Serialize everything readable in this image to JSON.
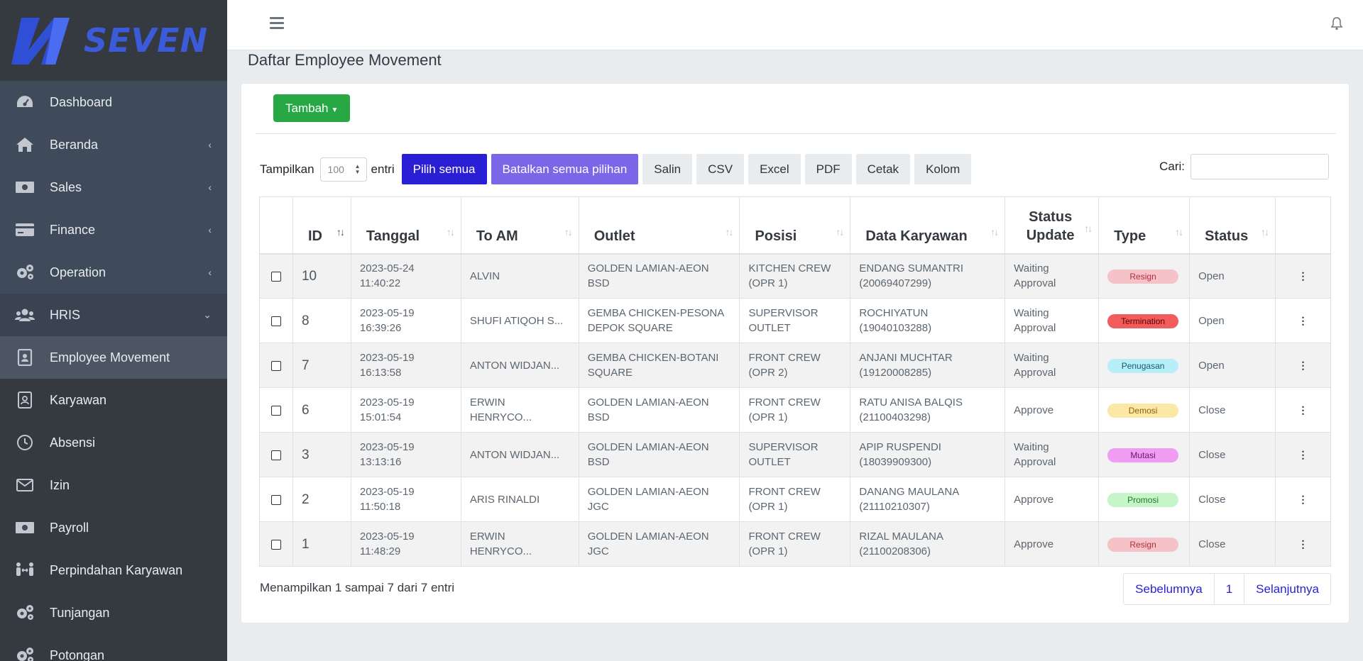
{
  "brand": {
    "name": "SEVEN",
    "color": "#3b5bdb"
  },
  "sidebar": {
    "items": [
      {
        "label": "Dashboard",
        "icon": "gauge-icon"
      },
      {
        "label": "Beranda",
        "icon": "home-icon",
        "chevron": "‹"
      },
      {
        "label": "Sales",
        "icon": "money-icon",
        "chevron": "‹"
      },
      {
        "label": "Finance",
        "icon": "credit-card-icon",
        "chevron": "‹"
      },
      {
        "label": "Operation",
        "icon": "cogs-icon",
        "chevron": "‹"
      },
      {
        "label": "HRIS",
        "icon": "users-icon",
        "chevron": "⌄"
      }
    ],
    "sub_items": [
      {
        "label": "Employee Movement",
        "icon": "id-badge-icon"
      },
      {
        "label": "Karyawan",
        "icon": "id-card-icon"
      },
      {
        "label": "Absensi",
        "icon": "clock-icon"
      },
      {
        "label": "Izin",
        "icon": "envelope-icon"
      },
      {
        "label": "Payroll",
        "icon": "money-icon"
      },
      {
        "label": "Perpindahan Karyawan",
        "icon": "people-arrows-icon"
      },
      {
        "label": "Tunjangan",
        "icon": "cogs-icon"
      },
      {
        "label": "Potongan",
        "icon": "cogs-icon"
      }
    ]
  },
  "page": {
    "title": "Daftar Employee Movement"
  },
  "toolbar": {
    "add_label": "Tambah",
    "show_label": "Tampilkan",
    "page_length": "100",
    "entries_label": "entri",
    "select_all": "Pilih semua",
    "deselect_all": "Batalkan semua pilihan",
    "buttons": [
      "Salin",
      "CSV",
      "Excel",
      "PDF",
      "Cetak",
      "Kolom"
    ],
    "search_label": "Cari:"
  },
  "table": {
    "columns": [
      "ID",
      "Tanggal",
      "To AM",
      "Outlet",
      "Posisi",
      "Data Karyawan",
      "Status Update",
      "Type",
      "Status"
    ],
    "rows": [
      {
        "id": "10",
        "date": "2023-05-24",
        "time": "11:40:22",
        "to_am": "ALVIN",
        "outlet1": "GOLDEN LAMIAN-AEON",
        "outlet2": "BSD",
        "pos1": "KITCHEN CREW",
        "pos2": "(OPR 1)",
        "name": "ENDANG SUMANTRI",
        "nik": "(20069407299)",
        "su1": "Waiting",
        "su2": "Approval",
        "type": "Resign",
        "status": "Open"
      },
      {
        "id": "8",
        "date": "2023-05-19",
        "time": "16:39:26",
        "to_am": "SHUFI ATIQOH S...",
        "outlet1": "GEMBA CHICKEN-PESONA",
        "outlet2": "DEPOK SQUARE",
        "pos1": "SUPERVISOR",
        "pos2": "OUTLET",
        "name": "ROCHIYATUN",
        "nik": "(19040103288)",
        "su1": "Waiting",
        "su2": "Approval",
        "type": "Termination",
        "status": "Open"
      },
      {
        "id": "7",
        "date": "2023-05-19",
        "time": "16:13:58",
        "to_am": "ANTON WIDJAN...",
        "outlet1": "GEMBA CHICKEN-BOTANI",
        "outlet2": "SQUARE",
        "pos1": "FRONT CREW",
        "pos2": "(OPR 2)",
        "name": "ANJANI MUCHTAR",
        "nik": "(19120008285)",
        "su1": "Waiting",
        "su2": "Approval",
        "type": "Penugasan",
        "status": "Open"
      },
      {
        "id": "6",
        "date": "2023-05-19",
        "time": "15:01:54",
        "to_am": "ERWIN HENRYCO...",
        "outlet1": "GOLDEN LAMIAN-AEON",
        "outlet2": "BSD",
        "pos1": "FRONT CREW",
        "pos2": "(OPR 1)",
        "name": "RATU ANISA BALQIS",
        "nik": "(21100403298)",
        "su1": "Approve",
        "su2": "",
        "type": "Demosi",
        "status": "Close"
      },
      {
        "id": "3",
        "date": "2023-05-19",
        "time": "13:13:16",
        "to_am": "ANTON WIDJAN...",
        "outlet1": "GOLDEN LAMIAN-AEON",
        "outlet2": "BSD",
        "pos1": "SUPERVISOR",
        "pos2": "OUTLET",
        "name": "APIP RUSPENDI",
        "nik": "(18039909300)",
        "su1": "Waiting",
        "su2": "Approval",
        "type": "Mutasi",
        "status": "Close"
      },
      {
        "id": "2",
        "date": "2023-05-19",
        "time": "11:50:18",
        "to_am": "ARIS RINALDI",
        "outlet1": "GOLDEN LAMIAN-AEON",
        "outlet2": "JGC",
        "pos1": "FRONT CREW",
        "pos2": "(OPR 1)",
        "name": "DANANG MAULANA",
        "nik": "(21110210307)",
        "su1": "Approve",
        "su2": "",
        "type": "Promosi",
        "status": "Close"
      },
      {
        "id": "1",
        "date": "2023-05-19",
        "time": "11:48:29",
        "to_am": "ERWIN HENRYCO...",
        "outlet1": "GOLDEN LAMIAN-AEON",
        "outlet2": "JGC",
        "pos1": "FRONT CREW",
        "pos2": "(OPR 1)",
        "name": "RIZAL MAULANA",
        "nik": "(21100208306)",
        "su1": "Approve",
        "su2": "",
        "type": "Resign",
        "status": "Close"
      }
    ]
  },
  "badge_colors": {
    "Resign": {
      "bg": "#f4c2c7",
      "fg": "#b0303c"
    },
    "Termination": {
      "bg": "#f25c5c",
      "fg": "#5a0000"
    },
    "Penugasan": {
      "bg": "#b8eef7",
      "fg": "#0b5f70"
    },
    "Demosi": {
      "bg": "#fbe7a6",
      "fg": "#8a6400"
    },
    "Mutasi": {
      "bg": "#ef9cf2",
      "fg": "#6a1670"
    },
    "Promosi": {
      "bg": "#c6f5c9",
      "fg": "#1f7a2a"
    }
  },
  "footer": {
    "info": "Menampilkan 1 sampai 7 dari 7 entri",
    "prev": "Sebelumnya",
    "page": "1",
    "next": "Selanjutnya"
  }
}
